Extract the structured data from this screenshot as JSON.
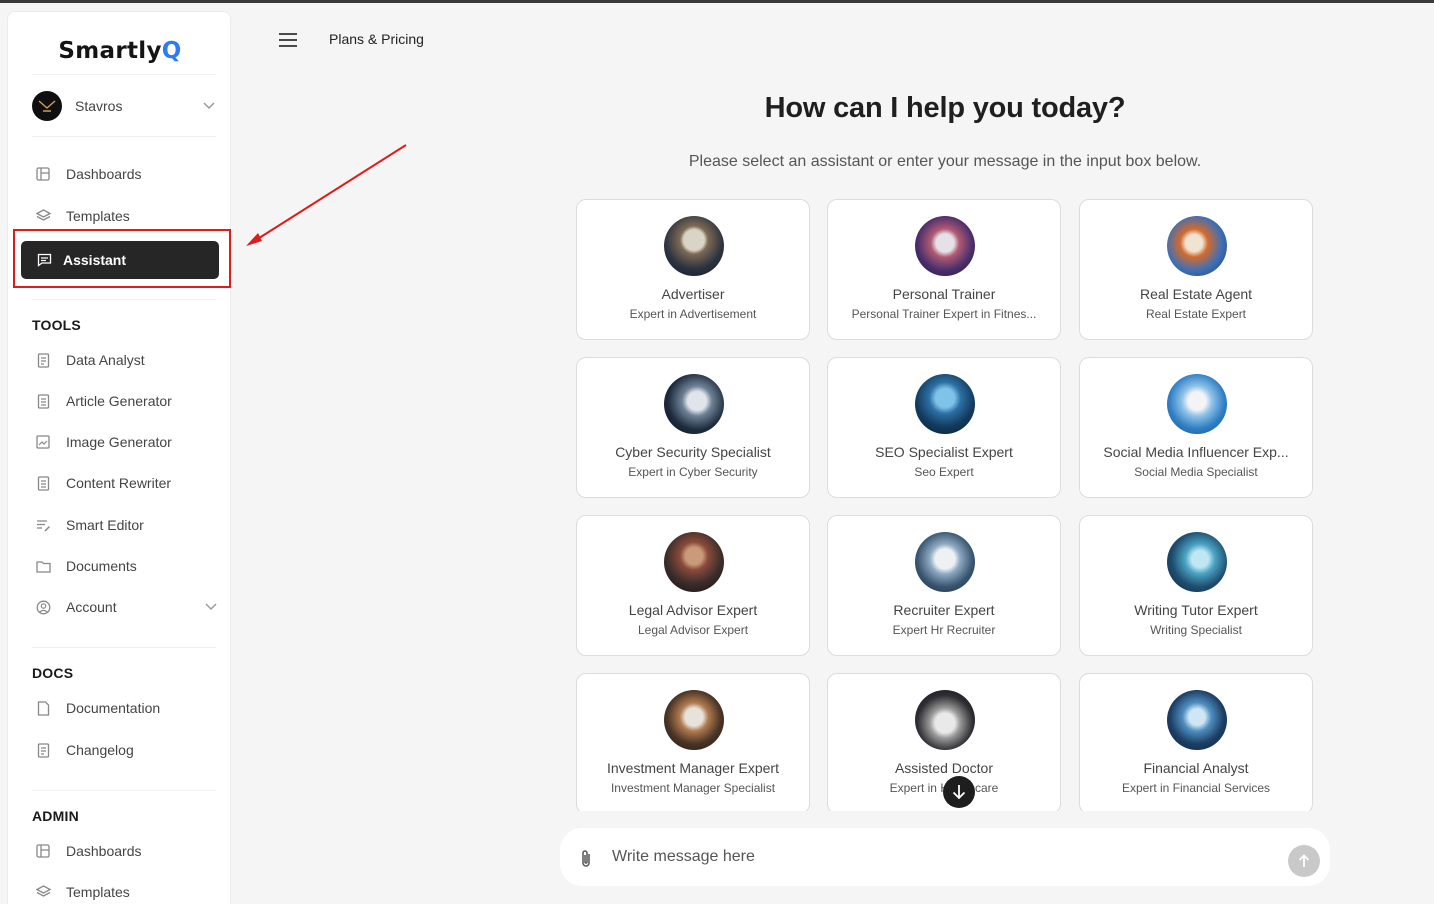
{
  "brand": {
    "name_prefix": "Smartly",
    "name_suffix": "Q"
  },
  "user": {
    "name": "Stavros"
  },
  "sidebar": {
    "main_items": [
      {
        "label": "Dashboards",
        "icon": "layout-icon"
      },
      {
        "label": "Templates",
        "icon": "layers-icon"
      },
      {
        "label": "Assistant",
        "icon": "chat-icon",
        "active": true
      }
    ],
    "tools_title": "TOOLS",
    "tools": [
      {
        "label": "Data Analyst",
        "icon": "file-chart-icon"
      },
      {
        "label": "Article Generator",
        "icon": "article-icon"
      },
      {
        "label": "Image Generator",
        "icon": "image-icon"
      },
      {
        "label": "Content Rewriter",
        "icon": "document-icon"
      },
      {
        "label": "Smart Editor",
        "icon": "edit-lines-icon"
      },
      {
        "label": "Documents",
        "icon": "folder-icon"
      },
      {
        "label": "Account",
        "icon": "user-circle-icon"
      }
    ],
    "docs_title": "DOCS",
    "docs": [
      {
        "label": "Documentation",
        "icon": "doc-icon"
      },
      {
        "label": "Changelog",
        "icon": "changelog-icon"
      }
    ],
    "admin_title": "ADMIN",
    "admin": [
      {
        "label": "Dashboards",
        "icon": "layout-icon"
      },
      {
        "label": "Templates",
        "icon": "layers-icon"
      }
    ]
  },
  "header": {
    "title": "Plans & Pricing"
  },
  "main": {
    "title": "How can I help you today?",
    "subtitle": "Please select an assistant or enter your message in the input box below."
  },
  "assistants": [
    {
      "name": "Advertiser",
      "desc": "Expert in Advertisement"
    },
    {
      "name": "Personal Trainer",
      "desc": "Personal Trainer Expert in Fitnes..."
    },
    {
      "name": "Real Estate Agent",
      "desc": "Real Estate Expert"
    },
    {
      "name": "Cyber Security Specialist",
      "desc": "Expert in Cyber Security"
    },
    {
      "name": "SEO Specialist Expert",
      "desc": "Seo Expert"
    },
    {
      "name": "Social Media Influencer Exp...",
      "desc": "Social Media Specialist"
    },
    {
      "name": "Legal Advisor Expert",
      "desc": "Legal Advisor Expert"
    },
    {
      "name": "Recruiter Expert",
      "desc": "Expert Hr Recruiter"
    },
    {
      "name": "Writing Tutor Expert",
      "desc": "Writing Specialist"
    },
    {
      "name": "Investment Manager Expert",
      "desc": "Investment Manager Specialist"
    },
    {
      "name": "Assisted Doctor",
      "desc": "Expert in Healthcare"
    },
    {
      "name": "Financial Analyst",
      "desc": "Expert in Financial Services"
    }
  ],
  "composer": {
    "placeholder": "Write message here"
  },
  "colors": {
    "accent": "#2f7bf6",
    "active_bg": "#262626",
    "highlight": "#e01b1b"
  }
}
